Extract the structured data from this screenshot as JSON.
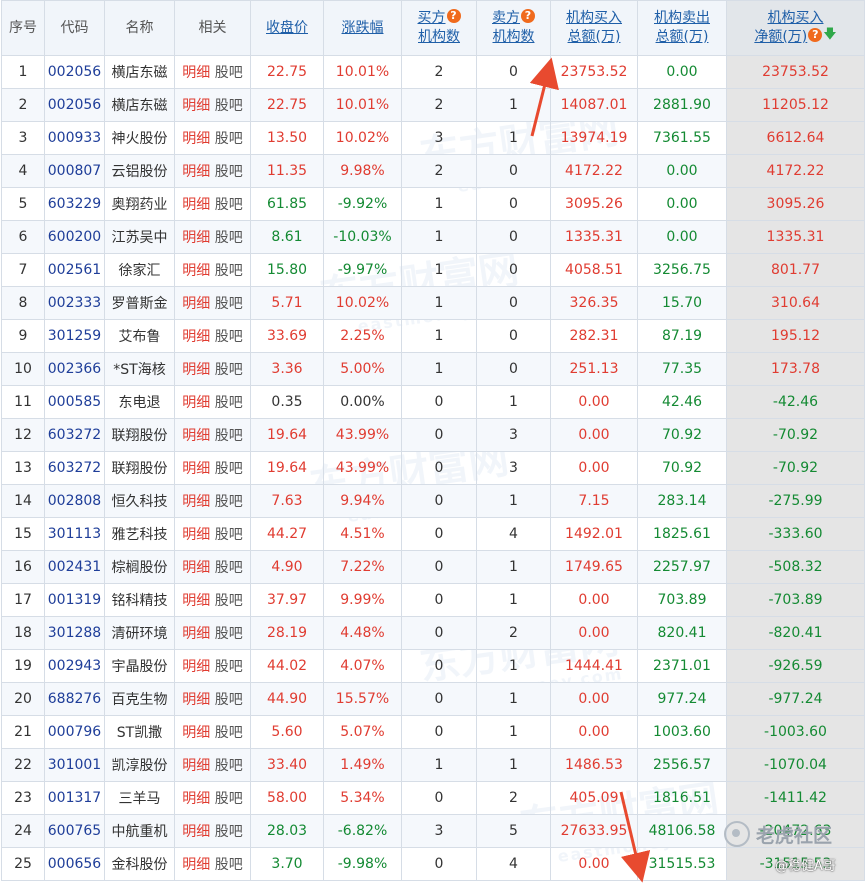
{
  "headers": {
    "seq": "序号",
    "code": "代码",
    "name": "名称",
    "related": "相关",
    "close": "收盘价",
    "change": "涨跌幅",
    "buy_count_l1": "买方",
    "buy_count_l2": "机构数",
    "sell_count_l1": "卖方",
    "sell_count_l2": "机构数",
    "buy_total_l1": "机构买入",
    "buy_total_l2": "总额(万)",
    "sell_total_l1": "机构卖出",
    "sell_total_l2": "总额(万)",
    "net_l1": "机构买入",
    "net_l2": "净额(万)"
  },
  "icons": {
    "help": "question-icon",
    "sort": "sort-desc-arrow-icon",
    "help_glyph": "?",
    "sort_glyph": "🡇"
  },
  "link_labels": {
    "detail": "明细",
    "bar": "股吧"
  },
  "colors": {
    "up": "#e03c31",
    "down": "#148a33",
    "code": "#1f3e99",
    "header_link": "#1f5fa8",
    "help_badge": "#f06a1d",
    "net_column_bg": "#e5e5e5"
  },
  "rows": [
    {
      "seq": "1",
      "code": "002056",
      "name": "横店东磁",
      "close": "22.75",
      "change": "10.01%",
      "buy_n": "2",
      "sell_n": "0",
      "buy": "23753.52",
      "sell": "0.00",
      "net": "23753.52"
    },
    {
      "seq": "2",
      "code": "002056",
      "name": "横店东磁",
      "close": "22.75",
      "change": "10.01%",
      "buy_n": "2",
      "sell_n": "1",
      "buy": "14087.01",
      "sell": "2881.90",
      "net": "11205.12"
    },
    {
      "seq": "3",
      "code": "000933",
      "name": "神火股份",
      "close": "13.50",
      "change": "10.02%",
      "buy_n": "3",
      "sell_n": "1",
      "buy": "13974.19",
      "sell": "7361.55",
      "net": "6612.64"
    },
    {
      "seq": "4",
      "code": "000807",
      "name": "云铝股份",
      "close": "11.35",
      "change": "9.98%",
      "buy_n": "2",
      "sell_n": "0",
      "buy": "4172.22",
      "sell": "0.00",
      "net": "4172.22"
    },
    {
      "seq": "5",
      "code": "603229",
      "name": "奥翔药业",
      "close": "61.85",
      "change": "-9.92%",
      "buy_n": "1",
      "sell_n": "0",
      "buy": "3095.26",
      "sell": "0.00",
      "net": "3095.26"
    },
    {
      "seq": "6",
      "code": "600200",
      "name": "江苏吴中",
      "close": "8.61",
      "change": "-10.03%",
      "buy_n": "1",
      "sell_n": "0",
      "buy": "1335.31",
      "sell": "0.00",
      "net": "1335.31"
    },
    {
      "seq": "7",
      "code": "002561",
      "name": "徐家汇",
      "close": "15.80",
      "change": "-9.97%",
      "buy_n": "1",
      "sell_n": "0",
      "buy": "4058.51",
      "sell": "3256.75",
      "net": "801.77"
    },
    {
      "seq": "8",
      "code": "002333",
      "name": "罗普斯金",
      "close": "5.71",
      "change": "10.02%",
      "buy_n": "1",
      "sell_n": "0",
      "buy": "326.35",
      "sell": "15.70",
      "net": "310.64"
    },
    {
      "seq": "9",
      "code": "301259",
      "name": "艾布鲁",
      "close": "33.69",
      "change": "2.25%",
      "buy_n": "1",
      "sell_n": "0",
      "buy": "282.31",
      "sell": "87.19",
      "net": "195.12"
    },
    {
      "seq": "10",
      "code": "002366",
      "name": "*ST海核",
      "close": "3.36",
      "change": "5.00%",
      "buy_n": "1",
      "sell_n": "0",
      "buy": "251.13",
      "sell": "77.35",
      "net": "173.78"
    },
    {
      "seq": "11",
      "code": "000585",
      "name": "东电退",
      "close": "0.35",
      "change": "0.00%",
      "buy_n": "0",
      "sell_n": "1",
      "buy": "0.00",
      "sell": "42.46",
      "net": "-42.46"
    },
    {
      "seq": "12",
      "code": "603272",
      "name": "联翔股份",
      "close": "19.64",
      "change": "43.99%",
      "buy_n": "0",
      "sell_n": "3",
      "buy": "0.00",
      "sell": "70.92",
      "net": "-70.92"
    },
    {
      "seq": "13",
      "code": "603272",
      "name": "联翔股份",
      "close": "19.64",
      "change": "43.99%",
      "buy_n": "0",
      "sell_n": "3",
      "buy": "0.00",
      "sell": "70.92",
      "net": "-70.92"
    },
    {
      "seq": "14",
      "code": "002808",
      "name": "恒久科技",
      "close": "7.63",
      "change": "9.94%",
      "buy_n": "0",
      "sell_n": "1",
      "buy": "7.15",
      "sell": "283.14",
      "net": "-275.99"
    },
    {
      "seq": "15",
      "code": "301113",
      "name": "雅艺科技",
      "close": "44.27",
      "change": "4.51%",
      "buy_n": "0",
      "sell_n": "4",
      "buy": "1492.01",
      "sell": "1825.61",
      "net": "-333.60"
    },
    {
      "seq": "16",
      "code": "002431",
      "name": "棕榈股份",
      "close": "4.90",
      "change": "7.22%",
      "buy_n": "0",
      "sell_n": "1",
      "buy": "1749.65",
      "sell": "2257.97",
      "net": "-508.32"
    },
    {
      "seq": "17",
      "code": "001319",
      "name": "铭科精技",
      "close": "37.97",
      "change": "9.99%",
      "buy_n": "0",
      "sell_n": "1",
      "buy": "0.00",
      "sell": "703.89",
      "net": "-703.89"
    },
    {
      "seq": "18",
      "code": "301288",
      "name": "清研环境",
      "close": "28.19",
      "change": "4.48%",
      "buy_n": "0",
      "sell_n": "2",
      "buy": "0.00",
      "sell": "820.41",
      "net": "-820.41"
    },
    {
      "seq": "19",
      "code": "002943",
      "name": "宇晶股份",
      "close": "44.02",
      "change": "4.07%",
      "buy_n": "0",
      "sell_n": "1",
      "buy": "1444.41",
      "sell": "2371.01",
      "net": "-926.59"
    },
    {
      "seq": "20",
      "code": "688276",
      "name": "百克生物",
      "close": "44.90",
      "change": "15.57%",
      "buy_n": "0",
      "sell_n": "1",
      "buy": "0.00",
      "sell": "977.24",
      "net": "-977.24"
    },
    {
      "seq": "21",
      "code": "000796",
      "name": "ST凯撒",
      "close": "5.60",
      "change": "5.07%",
      "buy_n": "0",
      "sell_n": "1",
      "buy": "0.00",
      "sell": "1003.60",
      "net": "-1003.60"
    },
    {
      "seq": "22",
      "code": "301001",
      "name": "凯淳股份",
      "close": "33.40",
      "change": "1.49%",
      "buy_n": "1",
      "sell_n": "1",
      "buy": "1486.53",
      "sell": "2556.57",
      "net": "-1070.04"
    },
    {
      "seq": "23",
      "code": "001317",
      "name": "三羊马",
      "close": "58.00",
      "change": "5.34%",
      "buy_n": "0",
      "sell_n": "2",
      "buy": "405.09",
      "sell": "1816.51",
      "net": "-1411.42"
    },
    {
      "seq": "24",
      "code": "600765",
      "name": "中航重机",
      "close": "28.03",
      "change": "-6.82%",
      "buy_n": "3",
      "sell_n": "5",
      "buy": "27633.95",
      "sell": "48106.58",
      "net": "-20472.63"
    },
    {
      "seq": "25",
      "code": "000656",
      "name": "金科股份",
      "close": "3.70",
      "change": "-9.98%",
      "buy_n": "0",
      "sell_n": "4",
      "buy": "0.00",
      "sell": "31515.53",
      "net": "-31515.53"
    }
  ],
  "watermark": {
    "brand": "东方财富网",
    "domain": "eastmoney.com"
  },
  "community": {
    "label": "老虎社区",
    "author": "@稳健A哥"
  }
}
